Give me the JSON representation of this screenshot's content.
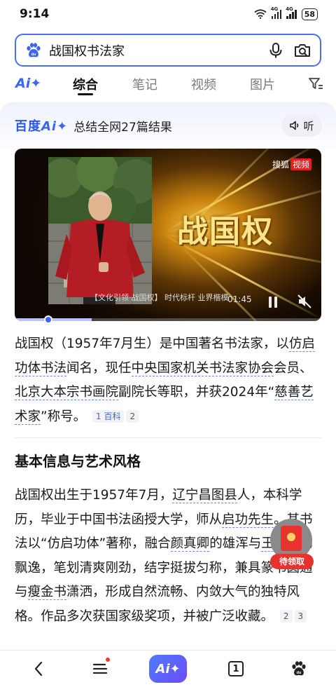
{
  "status_bar": {
    "time": "9:14",
    "network_1": "4G",
    "network_2": "4G",
    "battery": "58"
  },
  "search": {
    "query": "战国权书法家",
    "icons": [
      "baidu-paw-icon",
      "microphone-icon",
      "camera-search-icon"
    ]
  },
  "tabs": {
    "ai_label": "Ai✦",
    "items": [
      "综合",
      "笔记",
      "视频",
      "图片"
    ],
    "active": "综合"
  },
  "ai_card": {
    "logo_text": "百度",
    "logo_ai": "Ai✦",
    "summary": "总结全网27篇结果",
    "listen_label": "听"
  },
  "video": {
    "title": "战国权",
    "brand_name": "搜狐",
    "brand_tag": "视频",
    "caption": "【文化引领·战国权】 时代标杆 业界楷模",
    "time": "01:45",
    "progress": 0.25
  },
  "intro": {
    "p1": "战国权（1957年7月生）是中国著名书法家，以",
    "p1_ul1": "仿启功体书法",
    "p1_b": "闻名，现任",
    "p1_ul2": "中央国家机关书法家协会",
    "p1_c": "会员、",
    "p1_ul3": "北京大本宗书画院",
    "p1_d": "副院长等职，并获2024年“",
    "p1_ul4": "慈善艺术家",
    "p1_e": "”称号。",
    "ref1_num": "1",
    "ref1_src": "百科",
    "ref2": "2"
  },
  "section": {
    "title": "基本信息与艺术风格",
    "a": "战国权出生于1957年7月，",
    "ul_a": "辽宁昌图县",
    "b": "人，本科学历，毕业于中国书法函授大学，师从",
    "ul_b": "启功先生",
    "c": "。其书法以“仿启功体”著称，融合",
    "ul_c": "颜真卿",
    "d": "的雄浑与",
    "ul_d": "王羲之",
    "e": "的飘逸，笔划清爽刚劲，结字挺拔匀称，兼具篆书圆通与",
    "ul_e": "瘦金书",
    "f": "潇洒，形成自然流畅、内敛大气的独特风格。作品多次获国家级奖项，并被广泛收藏。",
    "ref_a": "2",
    "ref_b": "3"
  },
  "red_packet": {
    "label": "待领取"
  },
  "bottom_nav": {
    "ai_label": "Ai✦",
    "tab_count": "1"
  }
}
